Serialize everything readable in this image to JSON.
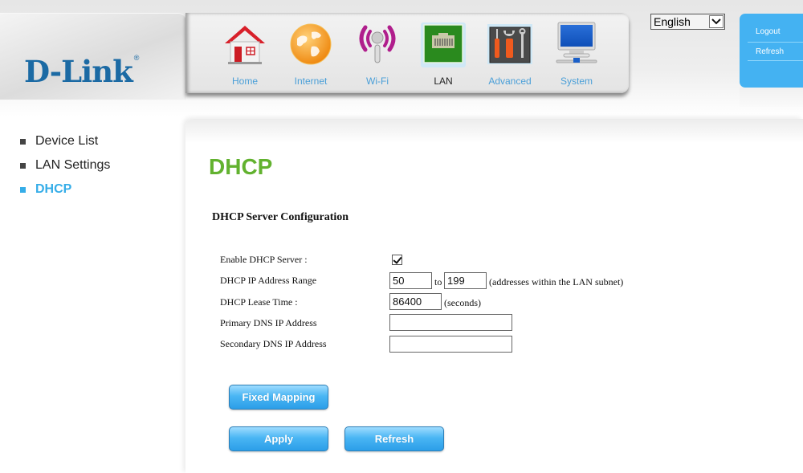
{
  "brand": {
    "logo_text": "D-Link",
    "registered_mark": "®"
  },
  "nav": {
    "items": [
      {
        "label": "Home",
        "icon": "home-icon",
        "active": false
      },
      {
        "label": "Internet",
        "icon": "globe-icon",
        "active": false
      },
      {
        "label": "Wi-Fi",
        "icon": "wifi-icon",
        "active": false
      },
      {
        "label": "LAN",
        "icon": "lan-port-icon",
        "active": true
      },
      {
        "label": "Advanced",
        "icon": "tools-icon",
        "active": false
      },
      {
        "label": "System",
        "icon": "monitor-icon",
        "active": false
      }
    ]
  },
  "language": {
    "selected": "English"
  },
  "user_menu": {
    "logout": "Logout",
    "refresh": "Refresh"
  },
  "sidebar": {
    "items": [
      {
        "label": "Device List",
        "active": false
      },
      {
        "label": "LAN Settings",
        "active": false
      },
      {
        "label": "DHCP",
        "active": true
      }
    ]
  },
  "page": {
    "title": "DHCP",
    "section_title": "DHCP Server Configuration",
    "fields": {
      "enable_label": "Enable DHCP Server :",
      "enable_checked": true,
      "range_label": "DHCP IP Address Range",
      "range_start": "50",
      "range_to": "to",
      "range_end": "199",
      "range_note": "(addresses within the LAN subnet)",
      "lease_label": "DHCP Lease Time :",
      "lease_value": "86400",
      "lease_note": "(seconds)",
      "primary_dns_label": "Primary DNS IP Address",
      "primary_dns_value": "",
      "secondary_dns_label": "Secondary DNS IP Address",
      "secondary_dns_value": ""
    },
    "buttons": {
      "fixed_mapping": "Fixed Mapping",
      "apply": "Apply",
      "refresh": "Refresh"
    }
  },
  "colors": {
    "brand_blue": "#1b6aa4",
    "title_green": "#62b22f",
    "accent_blue": "#35ade8",
    "user_box_blue": "#44b2f2"
  }
}
